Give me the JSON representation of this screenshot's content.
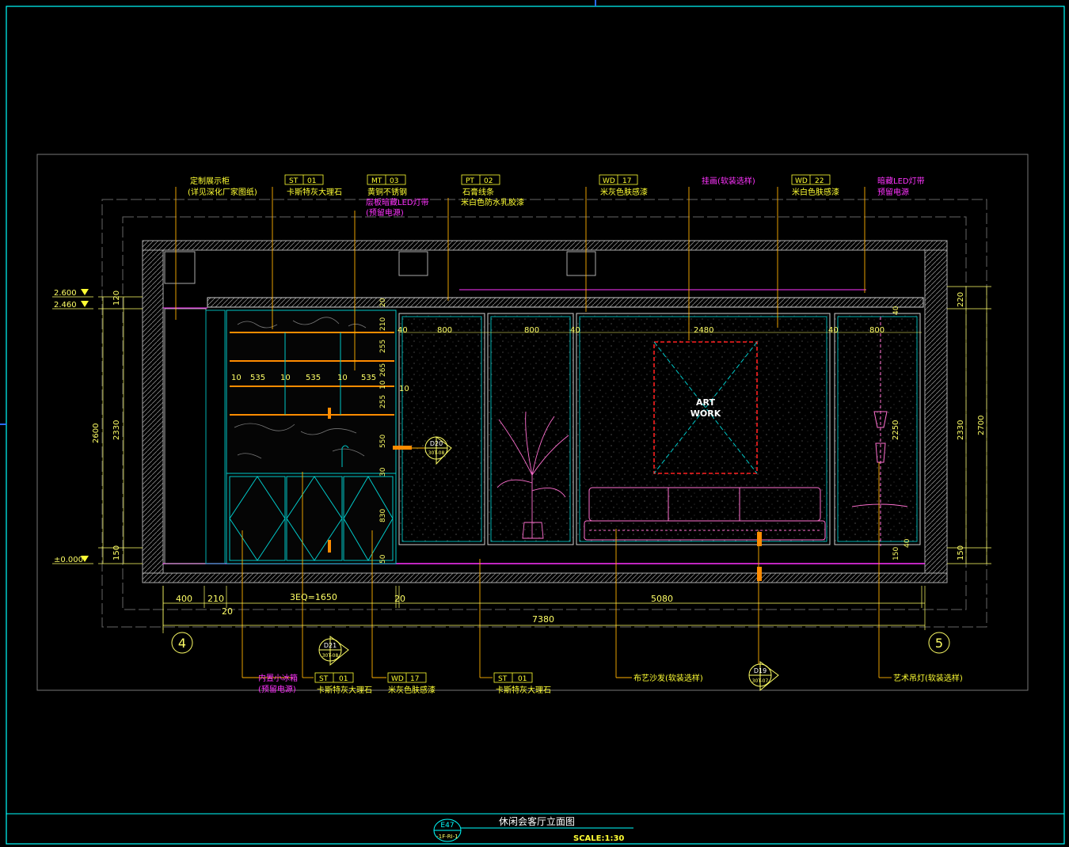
{
  "drawing": {
    "title": "休闲会客厅立面图",
    "scale": "SCALE:1:30",
    "sheet_no": "E47",
    "sheet_ref": "-1F-RI-1"
  },
  "colors": {
    "frame": "#00ffff",
    "leader": "#ffb000",
    "label_yellow": "#ffff33",
    "label_magenta": "#ff33ff",
    "dim": "#ffff66",
    "wall": "#b0b0b0",
    "artwork_red": "#ff2020",
    "artwork_cyan": "#00c8c8"
  },
  "callouts_top": [
    {
      "code": "",
      "num": "",
      "l1": "定制展示柜",
      "l2": "(详见深化厂家图纸)",
      "l3": "",
      "color": "yellow"
    },
    {
      "code": "ST",
      "num": "01",
      "l1": "卡斯特灰大理石",
      "l2": "",
      "l3": "",
      "color": "yellow"
    },
    {
      "code": "MT",
      "num": "03",
      "l1": "黄铜不锈钢",
      "l2": "层板暗藏LED灯带",
      "l3": "(预留电源)",
      "color": "mixed"
    },
    {
      "code": "PT",
      "num": "02",
      "l1": "石膏线条",
      "l2": "米白色防水乳胶漆",
      "l3": "",
      "color": "yellow"
    },
    {
      "code": "WD",
      "num": "17",
      "l1": "米灰色肤感漆",
      "l2": "",
      "l3": "",
      "color": "yellow"
    },
    {
      "code": "",
      "num": "",
      "l1": "挂画(软装选样)",
      "l2": "",
      "l3": "",
      "color": "magenta"
    },
    {
      "code": "WD",
      "num": "22",
      "l1": "米白色肤感漆",
      "l2": "",
      "l3": "",
      "color": "yellow"
    },
    {
      "code": "",
      "num": "",
      "l1": "暗藏LED灯带",
      "l2": "预留电源",
      "l3": "",
      "color": "magenta"
    }
  ],
  "callouts_bottom": [
    {
      "code": "",
      "num": "",
      "l1": "内置小冰箱",
      "l2": "(预留电源)",
      "color": "magenta"
    },
    {
      "code": "ST",
      "num": "01",
      "l1": "卡斯特灰大理石",
      "l2": "",
      "color": "yellow"
    },
    {
      "code": "WD",
      "num": "17",
      "l1": "米灰色肤感漆",
      "l2": "",
      "color": "yellow"
    },
    {
      "code": "ST",
      "num": "01",
      "l1": "卡斯特灰大理石",
      "l2": "",
      "color": "yellow"
    },
    {
      "code": "",
      "num": "",
      "l1": "布艺沙发(软装选样)",
      "l2": "",
      "color": "yellow"
    },
    {
      "code": "",
      "num": "",
      "l1": "艺术吊灯(软装选样)",
      "l2": "",
      "color": "yellow"
    }
  ],
  "levels": [
    "2.600",
    "2.460",
    "±0.000"
  ],
  "dims_left": [
    "120",
    "2600",
    "2330",
    "150"
  ],
  "dims_right": [
    "220",
    "2330",
    "2700",
    "150"
  ],
  "dims_bottom": [
    "400",
    "210",
    "3EQ=1650",
    "20",
    "5080",
    "20",
    "7380"
  ],
  "dims_cabinet": [
    "10",
    "535",
    "10",
    "535",
    "10",
    "535",
    "10"
  ],
  "dims_cabinet_v": [
    "20",
    "210",
    "255",
    "265",
    "10",
    "255",
    "550",
    "30",
    "830",
    "50"
  ],
  "dims_wall": [
    "40",
    "800",
    "800",
    "40",
    "2480",
    "40",
    "800",
    "40",
    "2250",
    "40",
    "150"
  ],
  "axes": [
    "4",
    "5"
  ],
  "section_marks": [
    {
      "id": "D20",
      "ref": "30T-08"
    },
    {
      "id": "D21",
      "ref": "30T-08"
    },
    {
      "id": "D19",
      "ref": "30T-07"
    }
  ],
  "artwork_text": [
    "ART",
    "WORK"
  ]
}
